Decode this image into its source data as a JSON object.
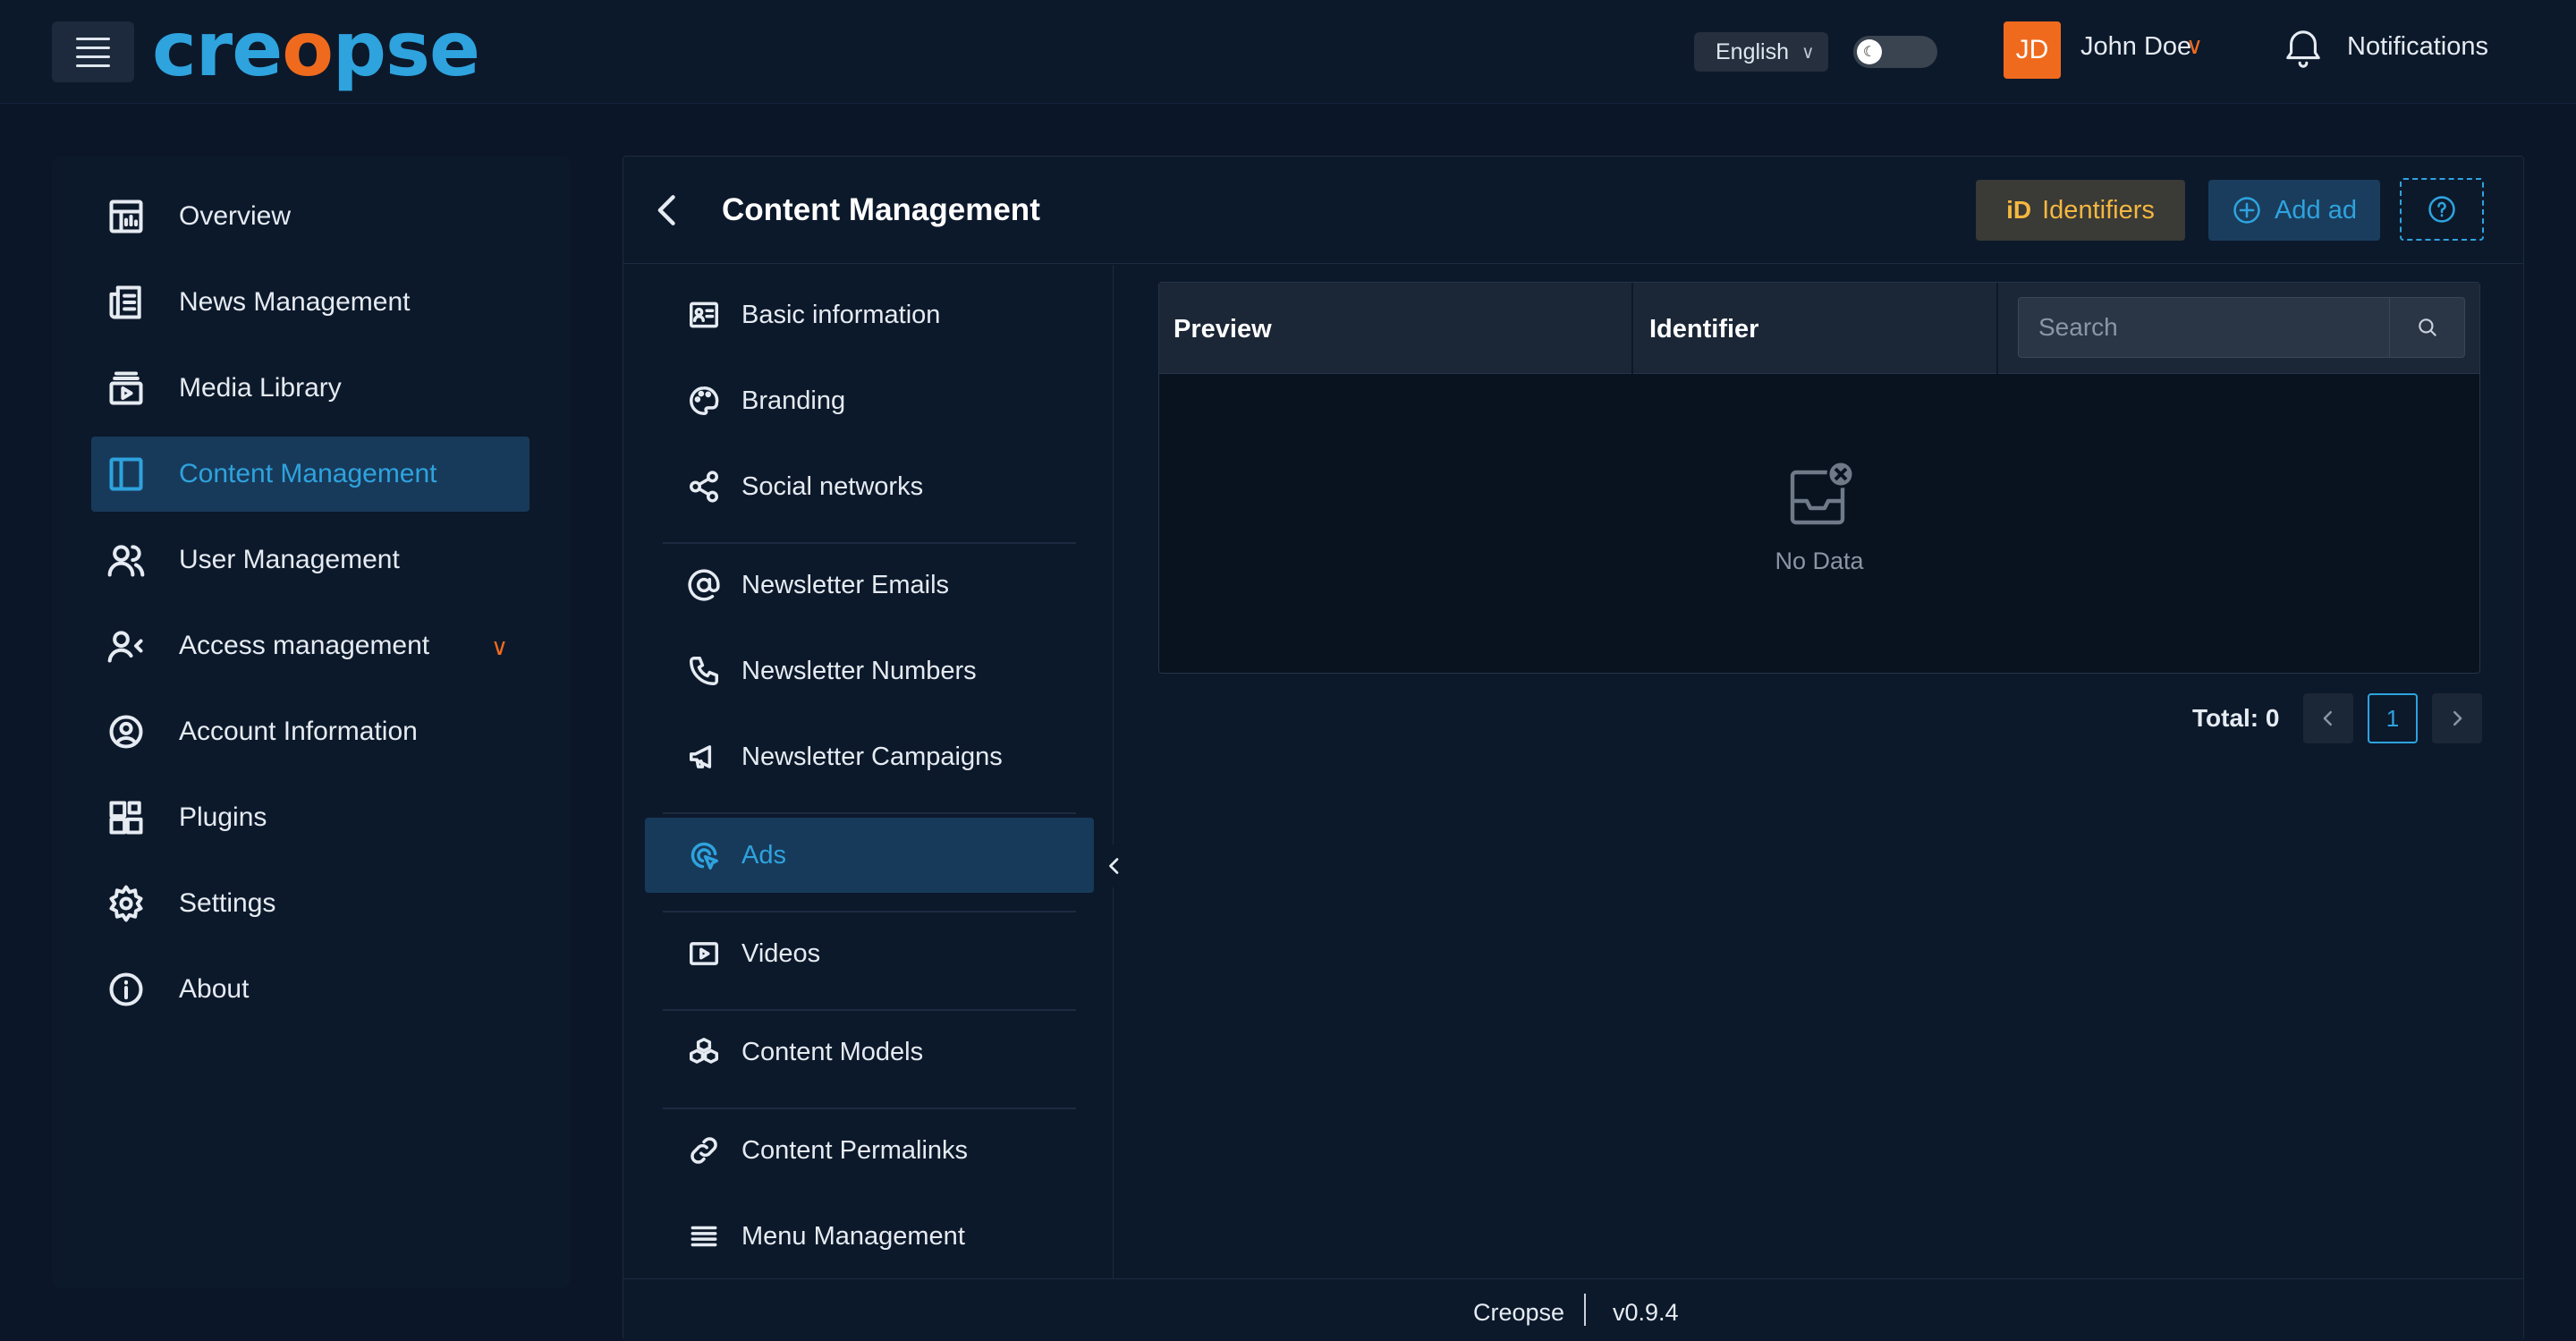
{
  "header": {
    "logo_text": "creopse",
    "language": "English",
    "user_initials": "JD",
    "user_name": "John Doe",
    "notifications_label": "Notifications"
  },
  "sidebar": {
    "items": [
      {
        "label": "Overview",
        "icon": "overview-icon"
      },
      {
        "label": "News Management",
        "icon": "news-icon"
      },
      {
        "label": "Media Library",
        "icon": "media-icon"
      },
      {
        "label": "Content Management",
        "icon": "content-icon",
        "active": true
      },
      {
        "label": "User Management",
        "icon": "users-icon"
      },
      {
        "label": "Access management",
        "icon": "access-icon",
        "expandable": true
      },
      {
        "label": "Account Information",
        "icon": "account-icon"
      },
      {
        "label": "Plugins",
        "icon": "plugins-icon"
      },
      {
        "label": "Settings",
        "icon": "gear-icon"
      },
      {
        "label": "About",
        "icon": "info-icon"
      }
    ]
  },
  "panel": {
    "title": "Content Management",
    "identifiers_label": "Identifiers",
    "identifiers_logo": "iD",
    "add_label": "Add ad"
  },
  "submenu": {
    "items": [
      {
        "label": "Basic information",
        "icon": "id-card-icon"
      },
      {
        "label": "Branding",
        "icon": "palette-icon"
      },
      {
        "label": "Social networks",
        "icon": "share-icon"
      },
      {
        "label": "Newsletter Emails",
        "icon": "at-icon"
      },
      {
        "label": "Newsletter Numbers",
        "icon": "phone-icon"
      },
      {
        "label": "Newsletter Campaigns",
        "icon": "megaphone-icon"
      },
      {
        "label": "Ads",
        "icon": "ads-icon",
        "active": true
      },
      {
        "label": "Videos",
        "icon": "video-icon"
      },
      {
        "label": "Content Models",
        "icon": "cubes-icon"
      },
      {
        "label": "Content Permalinks",
        "icon": "link-icon"
      },
      {
        "label": "Menu Management",
        "icon": "menu-icon"
      }
    ]
  },
  "table": {
    "columns": [
      "Preview",
      "Identifier"
    ],
    "search_placeholder": "Search",
    "empty_text": "No Data"
  },
  "pagination": {
    "total_label": "Total: 0",
    "current_page": "1"
  },
  "footer": {
    "brand": "Creopse",
    "version": "v0.9.4"
  },
  "colors": {
    "accent": "#2ea3de",
    "brand_orange": "#f06a1d",
    "identifiers": "#f4b740"
  }
}
